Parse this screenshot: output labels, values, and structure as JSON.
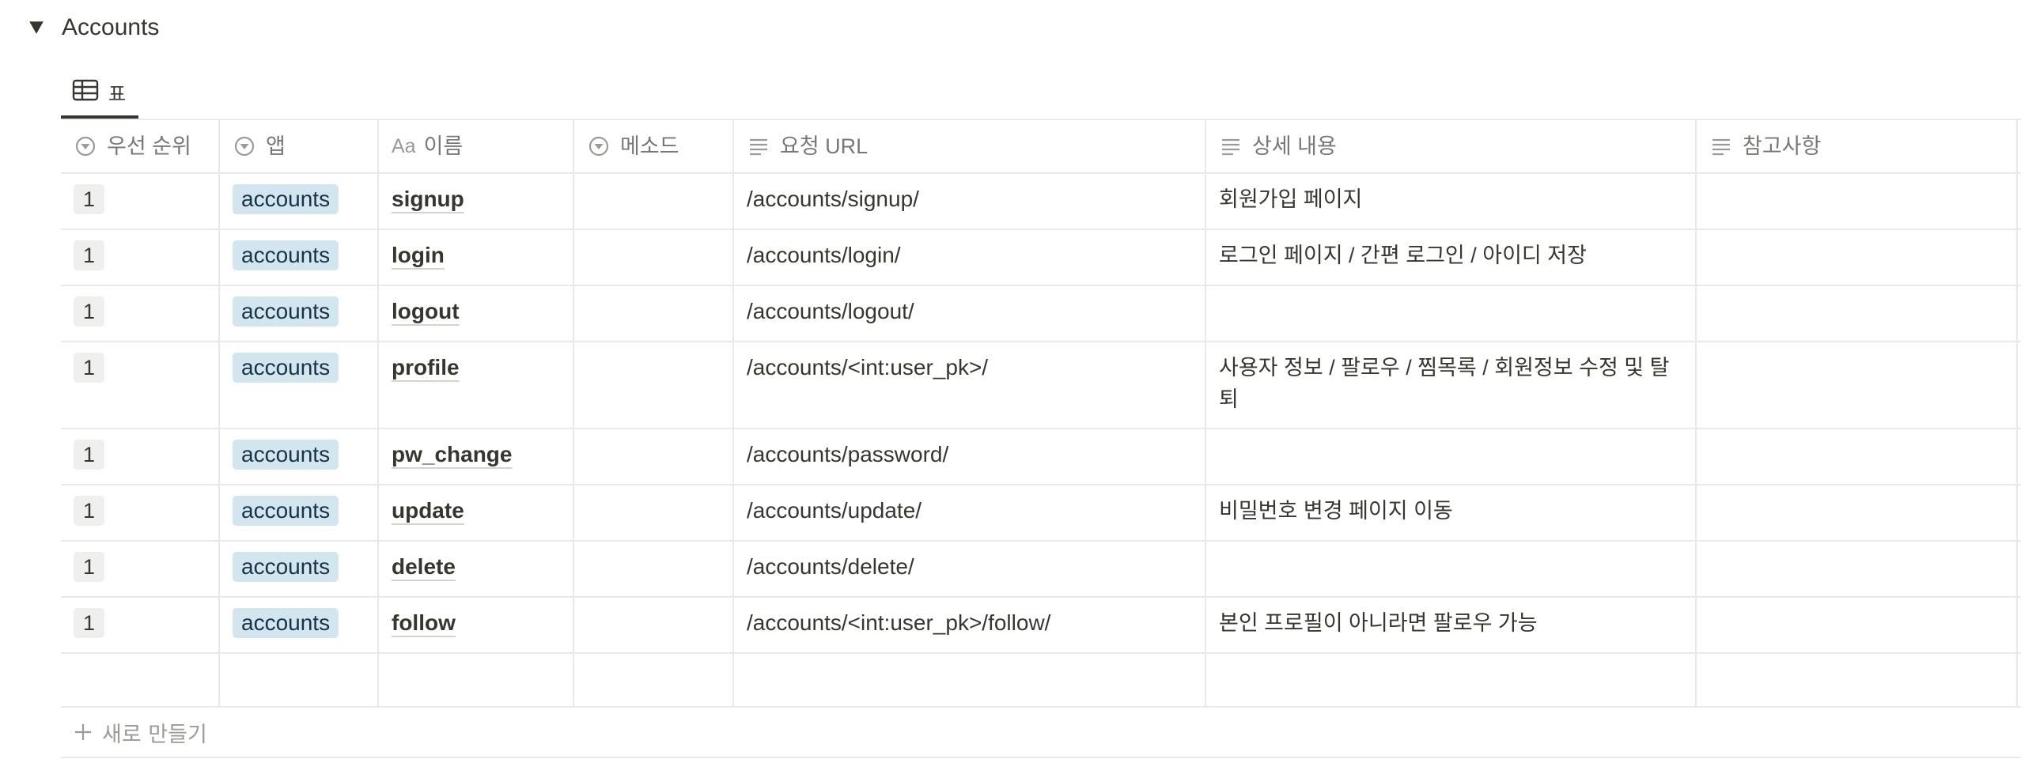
{
  "section": {
    "title": "Accounts"
  },
  "view": {
    "tab_label": "표"
  },
  "columns": [
    {
      "label": "우선 순위",
      "icon": "select-icon"
    },
    {
      "label": "앱",
      "icon": "select-icon"
    },
    {
      "label": "이름",
      "icon": "title-aa-icon",
      "icon_text": "Aa"
    },
    {
      "label": "메소드",
      "icon": "select-icon"
    },
    {
      "label": "요청 URL",
      "icon": "text-lines-icon"
    },
    {
      "label": "상세 내용",
      "icon": "text-lines-icon"
    },
    {
      "label": "참고사항",
      "icon": "text-lines-icon"
    }
  ],
  "rows": [
    {
      "priority": "1",
      "app": "accounts",
      "name": "signup",
      "method": "",
      "url": "/accounts/signup/",
      "detail": "회원가입 페이지",
      "note": ""
    },
    {
      "priority": "1",
      "app": "accounts",
      "name": "login",
      "method": "",
      "url": "/accounts/login/",
      "detail": "로그인 페이지 / 간편 로그인 / 아이디 저장",
      "note": ""
    },
    {
      "priority": "1",
      "app": "accounts",
      "name": "logout",
      "method": "",
      "url": "/accounts/logout/",
      "detail": "",
      "note": ""
    },
    {
      "priority": "1",
      "app": "accounts",
      "name": "profile",
      "method": "",
      "url": "/accounts/<int:user_pk>/",
      "detail": "사용자 정보 / 팔로우 / 찜목록 / 회원정보 수정 및 탈퇴",
      "note": ""
    },
    {
      "priority": "1",
      "app": "accounts",
      "name": "pw_change",
      "method": "",
      "url": "/accounts/password/",
      "detail": "",
      "note": ""
    },
    {
      "priority": "1",
      "app": "accounts",
      "name": "update",
      "method": "",
      "url": "/accounts/update/",
      "detail": "비밀번호 변경 페이지 이동",
      "note": ""
    },
    {
      "priority": "1",
      "app": "accounts",
      "name": "delete",
      "method": "",
      "url": "/accounts/delete/",
      "detail": "",
      "note": ""
    },
    {
      "priority": "1",
      "app": "accounts",
      "name": "follow",
      "method": "",
      "url": "/accounts/<int:user_pk>/follow/",
      "detail": "본인 프로필이 아니라면 팔로우 가능",
      "note": ""
    }
  ],
  "footer": {
    "new_label": "새로 만들기"
  },
  "colors": {
    "text": "#37352f",
    "muted": "#787774",
    "border": "#e9e9e7",
    "app_tag_bg": "#d3e5ef",
    "number_tag_bg": "#efefed"
  }
}
